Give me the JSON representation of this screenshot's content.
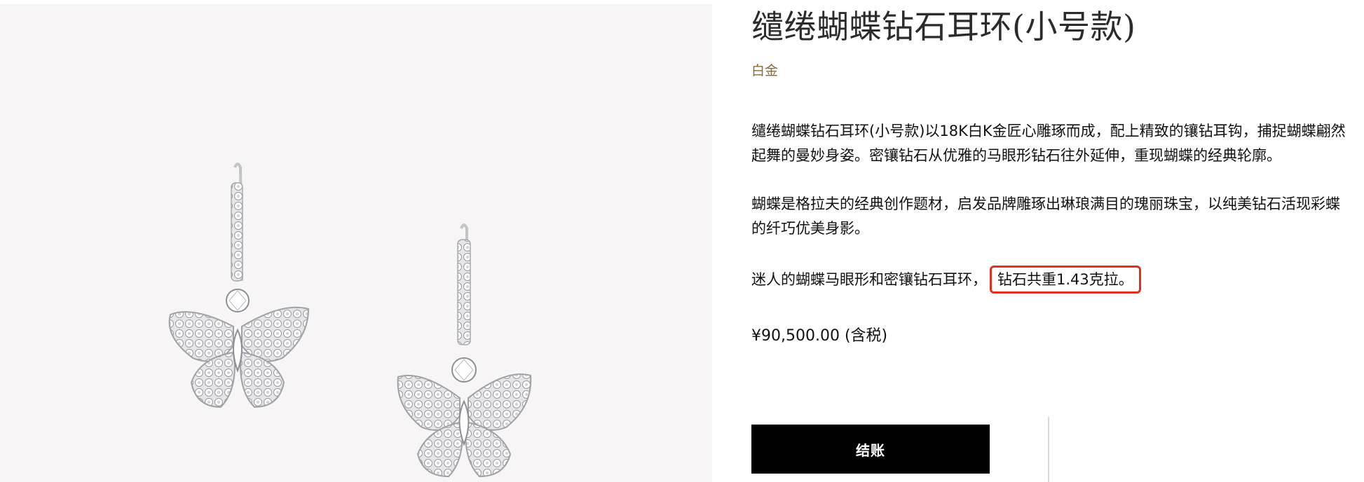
{
  "product": {
    "title": "缱绻蝴蝶钻石耳环(小号款)",
    "metal": "白金",
    "description_1": "缱绻蝴蝶钻石耳环(小号款)以18K白K金匠心雕琢而成，配上精致的镶钻耳钩，捕捉蝴蝶翩然起舞的曼妙身姿。密镶钻石从优雅的马眼形钻石往外延伸，重现蝴蝶的经典轮廓。",
    "description_2": "蝴蝶是格拉夫的经典创作题材，启发品牌雕琢出琳琅满目的瑰丽珠宝，以纯美钻石活现彩蝶的纤巧优美身影。",
    "description_3_prefix": "迷人的蝴蝶马眼形和密镶钻石耳环，",
    "description_3_highlight": "钻石共重1.43克拉。",
    "price": "¥90,500.00 (含税)",
    "checkout_label": "结账"
  },
  "colors": {
    "metal_text": "#8a6a3a",
    "highlight_border": "#e0301e",
    "button_bg": "#000000",
    "image_bg": "#f7f5f6"
  },
  "image": {
    "subject": "butterfly-diamond-earrings-pair"
  }
}
